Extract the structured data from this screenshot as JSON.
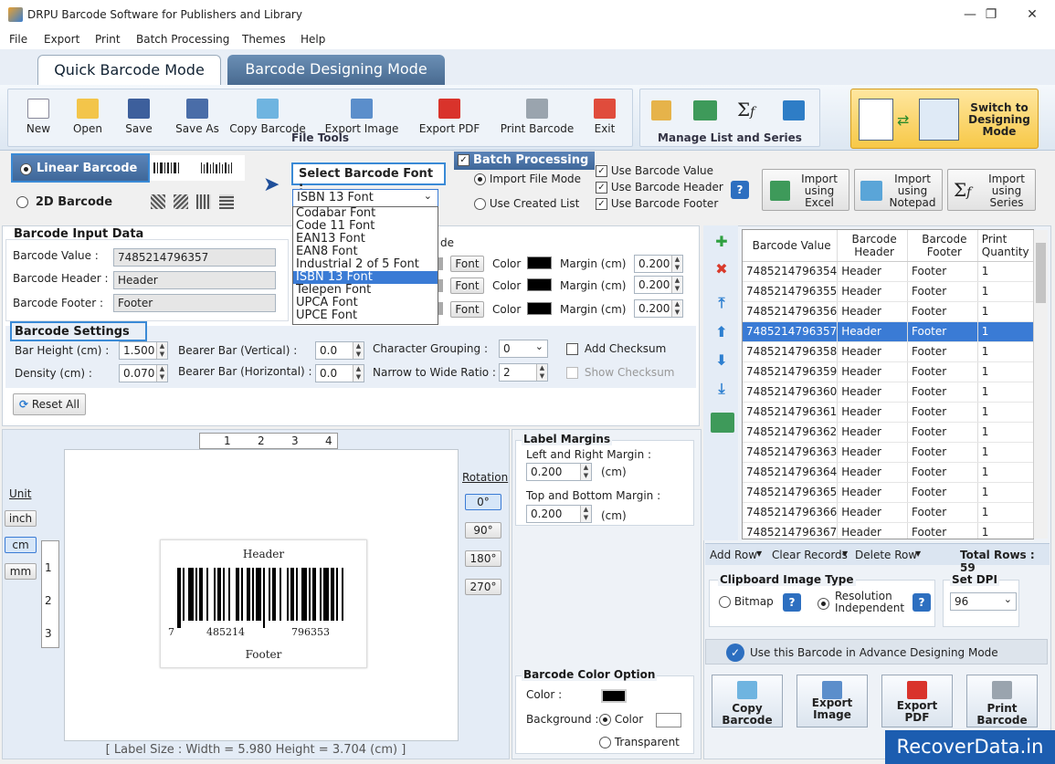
{
  "window": {
    "title": "DRPU Barcode Software for Publishers and Library",
    "min": "—",
    "max": "❐",
    "close": "✕"
  },
  "menu": [
    "File",
    "Export",
    "Print",
    "Batch Processing",
    "Themes",
    "Help"
  ],
  "tabs": {
    "quick": "Quick Barcode Mode",
    "designing": "Barcode Designing Mode"
  },
  "ribbon": {
    "file_tools": {
      "label": "File Tools",
      "buttons": [
        "New",
        "Open",
        "Save",
        "Save As",
        "Copy Barcode",
        "Export Image",
        "Export PDF",
        "Print Barcode",
        "Exit"
      ]
    },
    "manage": {
      "label": "Manage List and Series"
    },
    "switch": {
      "line1": "Switch to",
      "line2": "Designing",
      "line3": "Mode"
    }
  },
  "barcode_type": {
    "linear": "Linear Barcode",
    "twod": "2D Barcode"
  },
  "font_select": {
    "label": "Select Barcode Font :",
    "value": "ISBN 13 Font",
    "options": [
      "Codabar Font",
      "Code 11 Font",
      "EAN13 Font",
      "EAN8 Font",
      "Industrial 2 of 5 Font",
      "ISBN 13 Font",
      "Telepen Font",
      "UPCA Font",
      "UPCE Font"
    ]
  },
  "batch": {
    "title": "Batch Processing",
    "import_file": "Import File Mode",
    "use_created": "Use Created List",
    "use_value": "Use Barcode Value",
    "use_header": "Use Barcode Header",
    "use_footer": "Use Barcode Footer",
    "help": "?"
  },
  "imports": [
    {
      "l1": "Import",
      "l2": "using",
      "l3": "Excel"
    },
    {
      "l1": "Import",
      "l2": "using",
      "l3": "Notepad"
    },
    {
      "l1": "Import",
      "l2": "using",
      "l3": "Series"
    }
  ],
  "input": {
    "title": "Barcode Input Data",
    "value_label": "Barcode Value :",
    "value": "7485214796357",
    "header_label": "Barcode Header :",
    "header": "Header",
    "footer_label": "Barcode Footer :",
    "footer": "Footer",
    "partial": "de",
    "font_btn": "Font",
    "color_label": "Color",
    "margin_label": "Margin (cm)",
    "margins": [
      "0.200",
      "0.200",
      "0.200"
    ]
  },
  "settings": {
    "title": "Barcode Settings",
    "bar_height_label": "Bar Height (cm) :",
    "bar_height": "1.500",
    "density_label": "Density (cm) :",
    "density": "0.070",
    "bearer_v_label": "Bearer Bar (Vertical) :",
    "bearer_v": "0.0",
    "bearer_h_label": "Bearer Bar (Horizontal) :",
    "bearer_h": "0.0",
    "char_group_label": "Character Grouping :",
    "char_group": "0",
    "ratio_label": "Narrow to Wide Ratio :",
    "ratio": "2",
    "add_checksum": "Add Checksum",
    "show_checksum": "Show Checksum",
    "reset": "Reset All"
  },
  "preview": {
    "unit": "Unit",
    "units": [
      "inch",
      "cm",
      "mm"
    ],
    "ruler_h": [
      "1",
      "2",
      "3",
      "4"
    ],
    "ruler_v": [
      "1",
      "2",
      "3"
    ],
    "rotation": "Rotation",
    "rotations": [
      "0°",
      "90°",
      "180°",
      "270°"
    ],
    "header": "Header",
    "footer": "Footer",
    "digits": [
      "7",
      "485214",
      "796353"
    ],
    "label_size": "[ Label Size : Width = 5.980  Height = 3.704 (cm) ]"
  },
  "label_margins": {
    "title": "Label Margins",
    "lr_label": "Left and Right Margin :",
    "lr": "0.200",
    "tb_label": "Top and Bottom Margin :",
    "tb": "0.200",
    "unit": "(cm)"
  },
  "color_option": {
    "title": "Barcode Color Option",
    "color": "Color :",
    "background": "Background :",
    "bg_color": "Color",
    "transparent": "Transparent"
  },
  "grid": {
    "headers": [
      "Barcode Value",
      "Barcode Header",
      "Barcode Footer",
      "Print Quantity"
    ],
    "rows": [
      [
        "7485214796354",
        "Header",
        "Footer",
        "1"
      ],
      [
        "7485214796355",
        "Header",
        "Footer",
        "1"
      ],
      [
        "7485214796356",
        "Header",
        "Footer",
        "1"
      ],
      [
        "7485214796357",
        "Header",
        "Footer",
        "1"
      ],
      [
        "7485214796358",
        "Header",
        "Footer",
        "1"
      ],
      [
        "7485214796359",
        "Header",
        "Footer",
        "1"
      ],
      [
        "7485214796360",
        "Header",
        "Footer",
        "1"
      ],
      [
        "7485214796361",
        "Header",
        "Footer",
        "1"
      ],
      [
        "7485214796362",
        "Header",
        "Footer",
        "1"
      ],
      [
        "7485214796363",
        "Header",
        "Footer",
        "1"
      ],
      [
        "7485214796364",
        "Header",
        "Footer",
        "1"
      ],
      [
        "7485214796365",
        "Header",
        "Footer",
        "1"
      ],
      [
        "7485214796366",
        "Header",
        "Footer",
        "1"
      ],
      [
        "7485214796367",
        "Header",
        "Footer",
        "1"
      ]
    ],
    "selected": 3
  },
  "grid_tools": {
    "add_row": "Add Row",
    "clear": "Clear Records",
    "delete_row": "Delete Row",
    "total": "Total Rows : 59"
  },
  "clipboard": {
    "title": "Clipboard Image Type",
    "bitmap": "Bitmap",
    "res1": "Resolution",
    "res2": "Independent",
    "dpi_title": "Set DPI",
    "dpi": "96"
  },
  "advance": "Use this Barcode in Advance Designing Mode",
  "bottom_buttons": [
    {
      "l1": "Copy",
      "l2": "Barcode"
    },
    {
      "l1": "Export",
      "l2": "Image"
    },
    {
      "l1": "Export",
      "l2": "PDF"
    },
    {
      "l1": "Print",
      "l2": "Barcode"
    }
  ],
  "watermark": "RecoverData.in"
}
